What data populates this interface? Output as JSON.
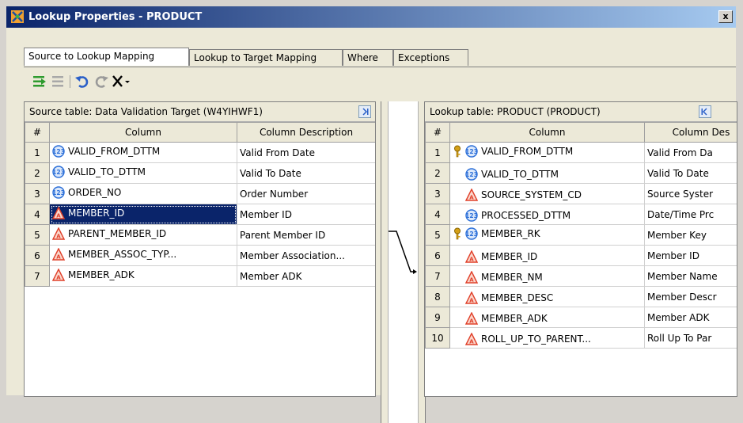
{
  "window": {
    "title": "Lookup Properties - PRODUCT",
    "close_label": "x"
  },
  "tabs": [
    {
      "label": "Source to Lookup Mapping",
      "active": true
    },
    {
      "label": "Lookup to Target Mapping",
      "active": false
    },
    {
      "label": "Where",
      "active": false
    },
    {
      "label": "Exceptions",
      "active": false
    }
  ],
  "toolbar": [
    "map-all-icon",
    "unmap-all-icon",
    "undo-icon",
    "redo-icon",
    "delete-mapping-icon"
  ],
  "source": {
    "title": "Source table: Data Validation Target (W4YIHWF1)",
    "headers": {
      "num": "#",
      "column": "Column",
      "description": "Column Description"
    },
    "rows": [
      {
        "num": "1",
        "column": "VALID_FROM_DTTM",
        "type": "numeric",
        "description": "Valid From Date"
      },
      {
        "num": "2",
        "column": "VALID_TO_DTTM",
        "type": "numeric",
        "description": "Valid To Date"
      },
      {
        "num": "3",
        "column": "ORDER_NO",
        "type": "numeric",
        "description": "Order Number"
      },
      {
        "num": "4",
        "column": "MEMBER_ID",
        "type": "character",
        "description": "Member ID",
        "selected": true
      },
      {
        "num": "5",
        "column": "PARENT_MEMBER_ID",
        "type": "character",
        "description": "Parent Member ID"
      },
      {
        "num": "6",
        "column": "MEMBER_ASSOC_TYP...",
        "type": "character",
        "description": "Member Association..."
      },
      {
        "num": "7",
        "column": "MEMBER_ADK",
        "type": "character",
        "description": "Member ADK"
      }
    ]
  },
  "lookup": {
    "title": "Lookup table: PRODUCT (PRODUCT)",
    "headers": {
      "num": "#",
      "column": "Column",
      "description": "Column Des"
    },
    "rows": [
      {
        "num": "1",
        "column": "VALID_FROM_DTTM",
        "type": "numeric",
        "key": true,
        "description": "Valid From Da"
      },
      {
        "num": "2",
        "column": "VALID_TO_DTTM",
        "type": "numeric",
        "key": false,
        "description": "Valid To Date"
      },
      {
        "num": "3",
        "column": "SOURCE_SYSTEM_CD",
        "type": "character",
        "key": false,
        "description": "Source Syster"
      },
      {
        "num": "4",
        "column": "PROCESSED_DTTM",
        "type": "numeric",
        "key": false,
        "description": "Date/Time Prc"
      },
      {
        "num": "5",
        "column": "MEMBER_RK",
        "type": "numeric",
        "key": true,
        "description": "Member Key"
      },
      {
        "num": "6",
        "column": "MEMBER_ID",
        "type": "character",
        "key": false,
        "description": "Member ID"
      },
      {
        "num": "7",
        "column": "MEMBER_NM",
        "type": "character",
        "key": false,
        "description": "Member Name"
      },
      {
        "num": "8",
        "column": "MEMBER_DESC",
        "type": "character",
        "key": false,
        "description": "Member Descr"
      },
      {
        "num": "9",
        "column": "MEMBER_ADK",
        "type": "character",
        "key": false,
        "description": "Member ADK"
      },
      {
        "num": "10",
        "column": "ROLL_UP_TO_PARENT...",
        "type": "character",
        "key": false,
        "description": "Roll Up To Par"
      }
    ]
  },
  "mapping": {
    "from_source_row": "4",
    "to_lookup_row": "6"
  },
  "colors": {
    "titlebar_start": "#0a246a",
    "selection": "#0a246a",
    "numeric_icon": "#2a6ed8",
    "character_icon": "#e0402a",
    "key_icon": "#d4a017"
  }
}
